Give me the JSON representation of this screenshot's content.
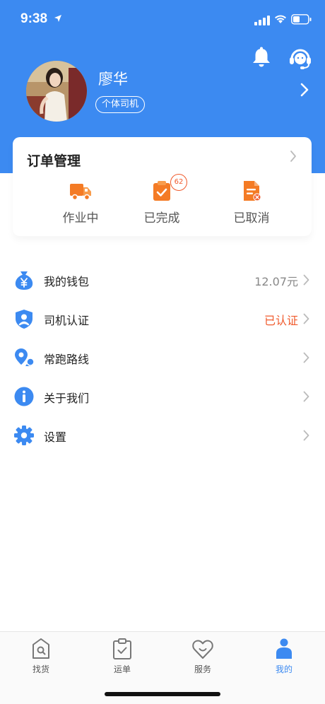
{
  "status_bar": {
    "time": "9:38"
  },
  "profile": {
    "name": "廖华",
    "badge": "个体司机"
  },
  "order_management": {
    "title": "订单管理",
    "items": [
      {
        "label": "作业中",
        "icon": "truck-icon"
      },
      {
        "label": "已完成",
        "icon": "clipboard-check-icon",
        "badge": "62"
      },
      {
        "label": "已取消",
        "icon": "document-cancel-icon"
      }
    ]
  },
  "menu": [
    {
      "label": "我的钱包",
      "value": "12.07元",
      "icon": "money-bag-icon"
    },
    {
      "label": "司机认证",
      "value": "已认证",
      "icon": "shield-user-icon"
    },
    {
      "label": "常跑路线",
      "value": "",
      "icon": "route-pin-icon"
    },
    {
      "label": "关于我们",
      "value": "",
      "icon": "info-icon"
    },
    {
      "label": "设置",
      "value": "",
      "icon": "gear-icon"
    }
  ],
  "tabbar": [
    {
      "label": "找货",
      "icon": "search-bag-icon",
      "active": false
    },
    {
      "label": "运单",
      "icon": "clipboard-icon",
      "active": false
    },
    {
      "label": "服务",
      "icon": "heart-smile-icon",
      "active": false
    },
    {
      "label": "我的",
      "icon": "person-icon",
      "active": true
    }
  ],
  "colors": {
    "primary": "#3c8af1",
    "accent_orange": "#f47b25",
    "verified_red": "#f05a2c",
    "text_dark": "#222222",
    "text_muted": "#888888"
  }
}
